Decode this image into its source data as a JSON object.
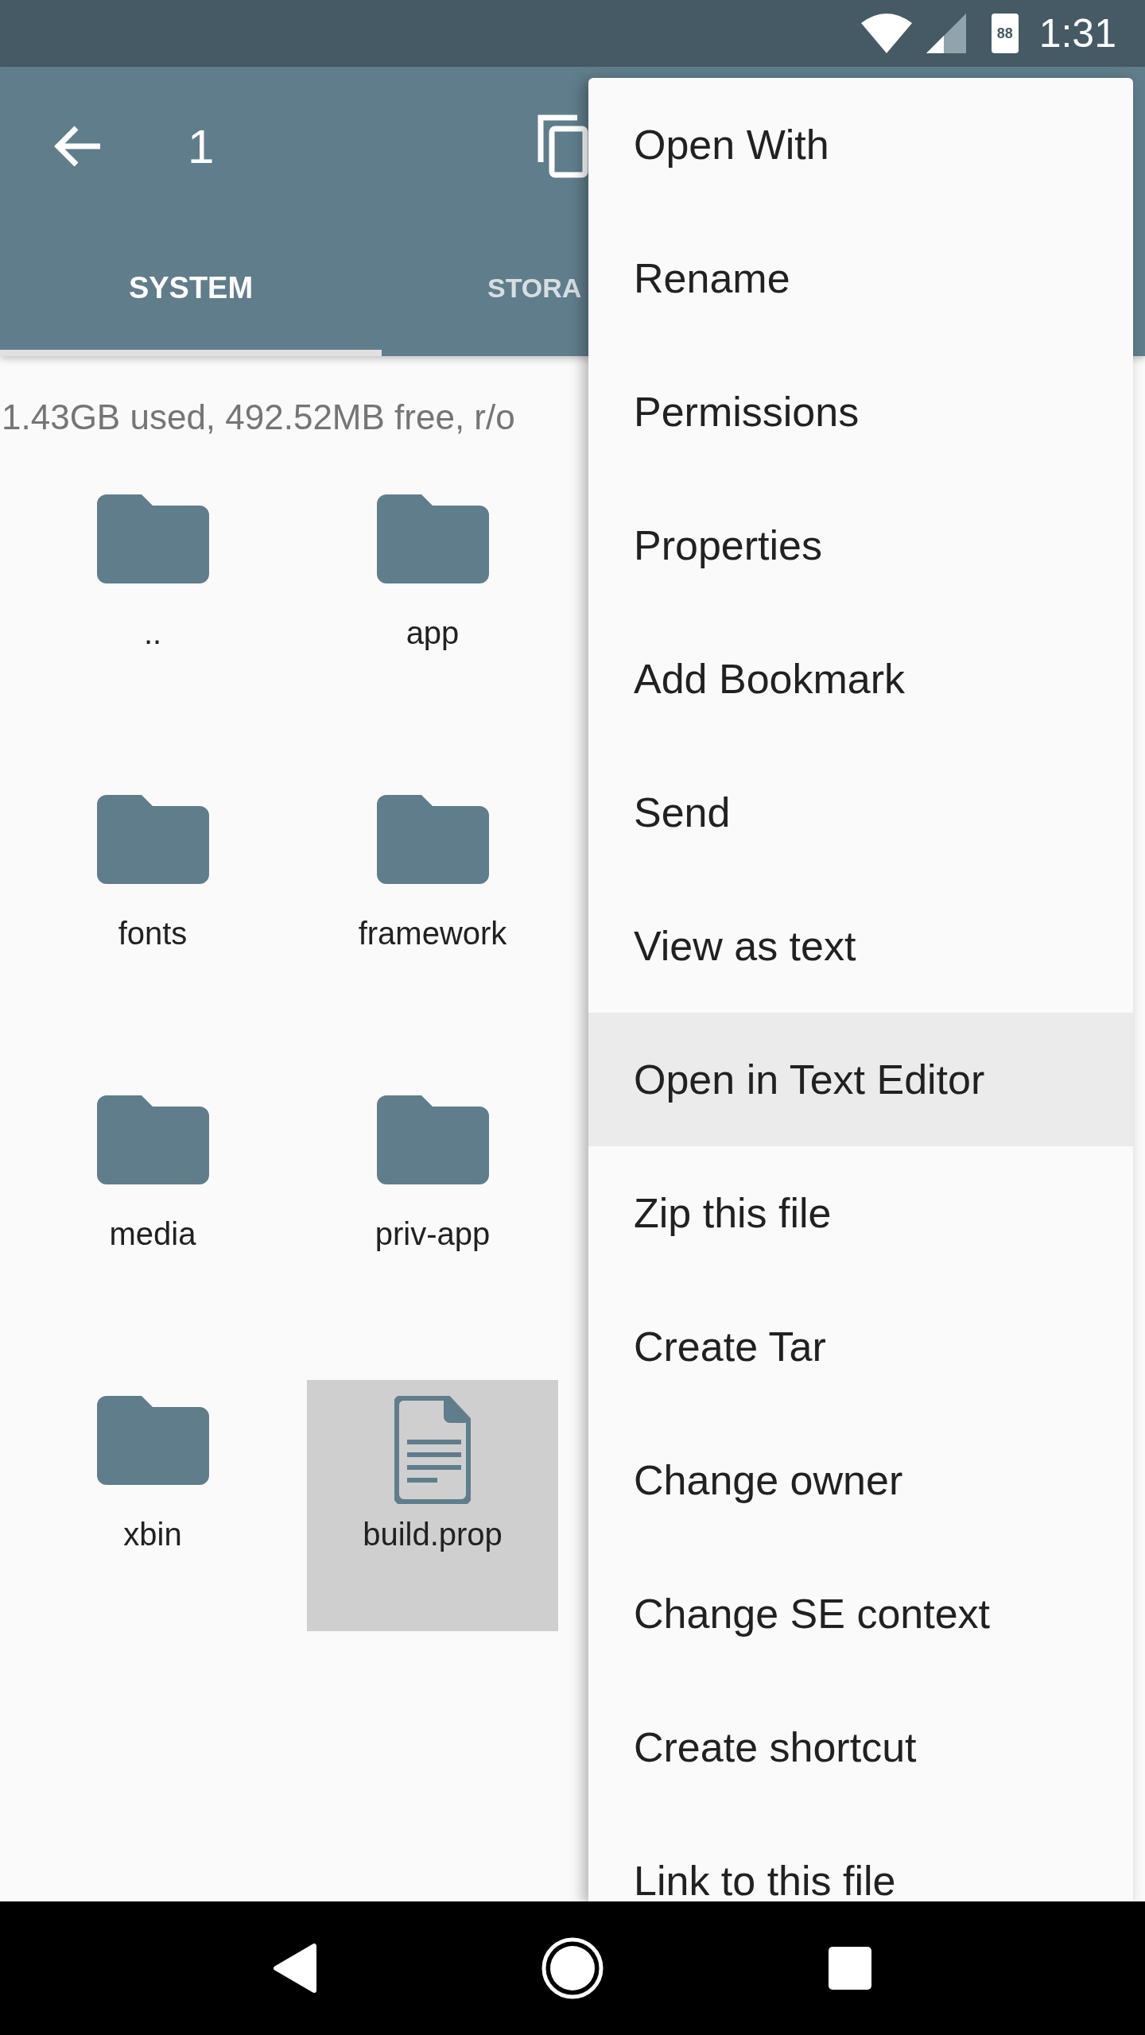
{
  "status_bar": {
    "battery_text": "88",
    "time": "1:31"
  },
  "toolbar": {
    "title": "1"
  },
  "tabs": [
    {
      "label": "SYSTEM",
      "selected": true
    },
    {
      "label": "STORA",
      "selected": false
    }
  ],
  "storage_info": "1.43GB used, 492.52MB free, r/o",
  "files": [
    {
      "name": "..",
      "kind": "folder",
      "selected": false
    },
    {
      "name": "app",
      "kind": "folder",
      "selected": false
    },
    {
      "name": "fonts",
      "kind": "folder",
      "selected": false
    },
    {
      "name": "framework",
      "kind": "folder",
      "selected": false
    },
    {
      "name": "media",
      "kind": "folder",
      "selected": false
    },
    {
      "name": "priv-app",
      "kind": "folder",
      "selected": false
    },
    {
      "name": "xbin",
      "kind": "folder",
      "selected": false
    },
    {
      "name": "build.prop",
      "kind": "file",
      "selected": true
    }
  ],
  "menu": [
    {
      "label": "Open With",
      "selected": false
    },
    {
      "label": "Rename",
      "selected": false
    },
    {
      "label": "Permissions",
      "selected": false
    },
    {
      "label": "Properties",
      "selected": false
    },
    {
      "label": "Add Bookmark",
      "selected": false
    },
    {
      "label": "Send",
      "selected": false
    },
    {
      "label": "View as text",
      "selected": false
    },
    {
      "label": "Open in Text Editor",
      "selected": true
    },
    {
      "label": "Zip this file",
      "selected": false
    },
    {
      "label": "Create Tar",
      "selected": false
    },
    {
      "label": "Change owner",
      "selected": false
    },
    {
      "label": "Change SE context",
      "selected": false
    },
    {
      "label": "Create shortcut",
      "selected": false
    },
    {
      "label": "Link to this file",
      "selected": false
    }
  ]
}
